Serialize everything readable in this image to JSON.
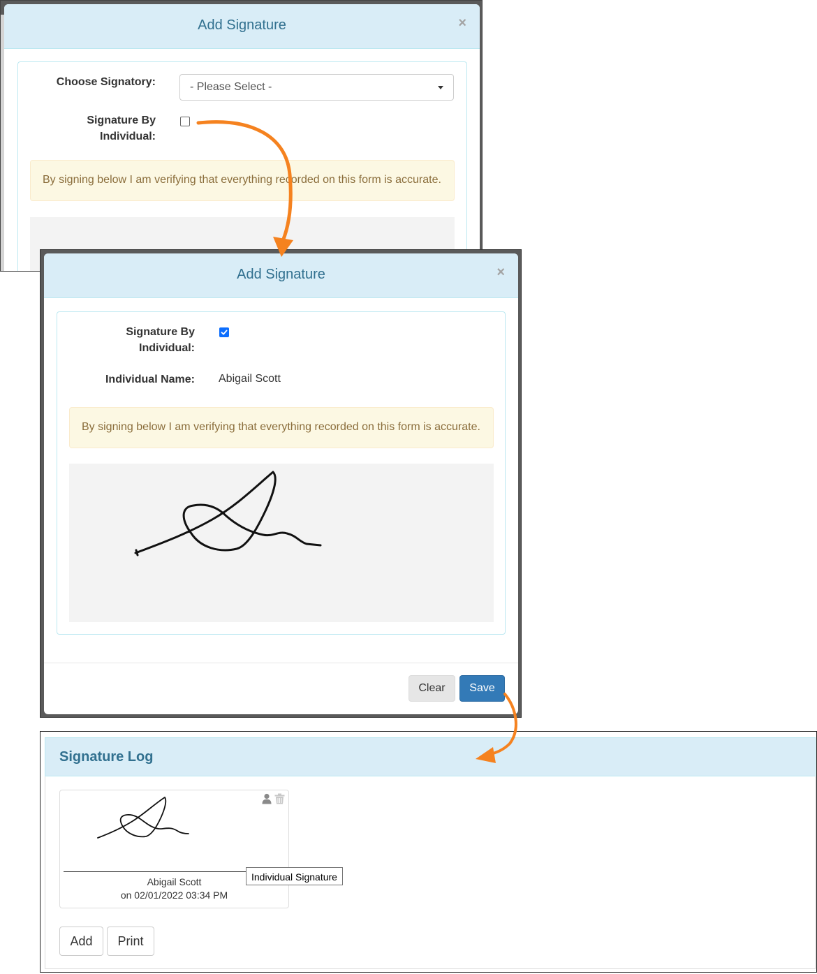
{
  "step1": {
    "modal_title": "Add Signature",
    "close_glyph": "×",
    "choose_signatory_label": "Choose Signatory:",
    "select_value": "- Please Select -",
    "signature_by_individual_label_line1": "Signature By",
    "signature_by_individual_label_line2": "Individual:",
    "signature_by_individual_checked": false,
    "notice": "By signing below I am verifying that everything recorded on this form is accurate."
  },
  "step2": {
    "modal_title": "Add Signature",
    "close_glyph": "×",
    "signature_by_individual_label_line1": "Signature By",
    "signature_by_individual_label_line2": "Individual:",
    "signature_by_individual_checked": true,
    "individual_name_label": "Individual Name:",
    "individual_name_value": "Abigail Scott",
    "notice": "By signing below I am verifying that everything recorded on this form is accurate.",
    "clear_label": "Clear",
    "save_label": "Save"
  },
  "step3": {
    "title": "Signature Log",
    "card": {
      "name": "Abigail Scott",
      "date": "on 02/01/2022 03:34 PM",
      "icons": [
        "person-icon",
        "trash-icon"
      ],
      "tooltip": "Individual Signature"
    },
    "add_label": "Add",
    "print_label": "Print"
  },
  "colors": {
    "header_bg": "#d9edf7",
    "title_color": "#31708f",
    "alert_bg": "#fcf8e3",
    "alert_text": "#8a6d3b",
    "primary": "#337ab7",
    "arrow": "#f5821f",
    "checkbox_checked": "#0d6efd"
  }
}
